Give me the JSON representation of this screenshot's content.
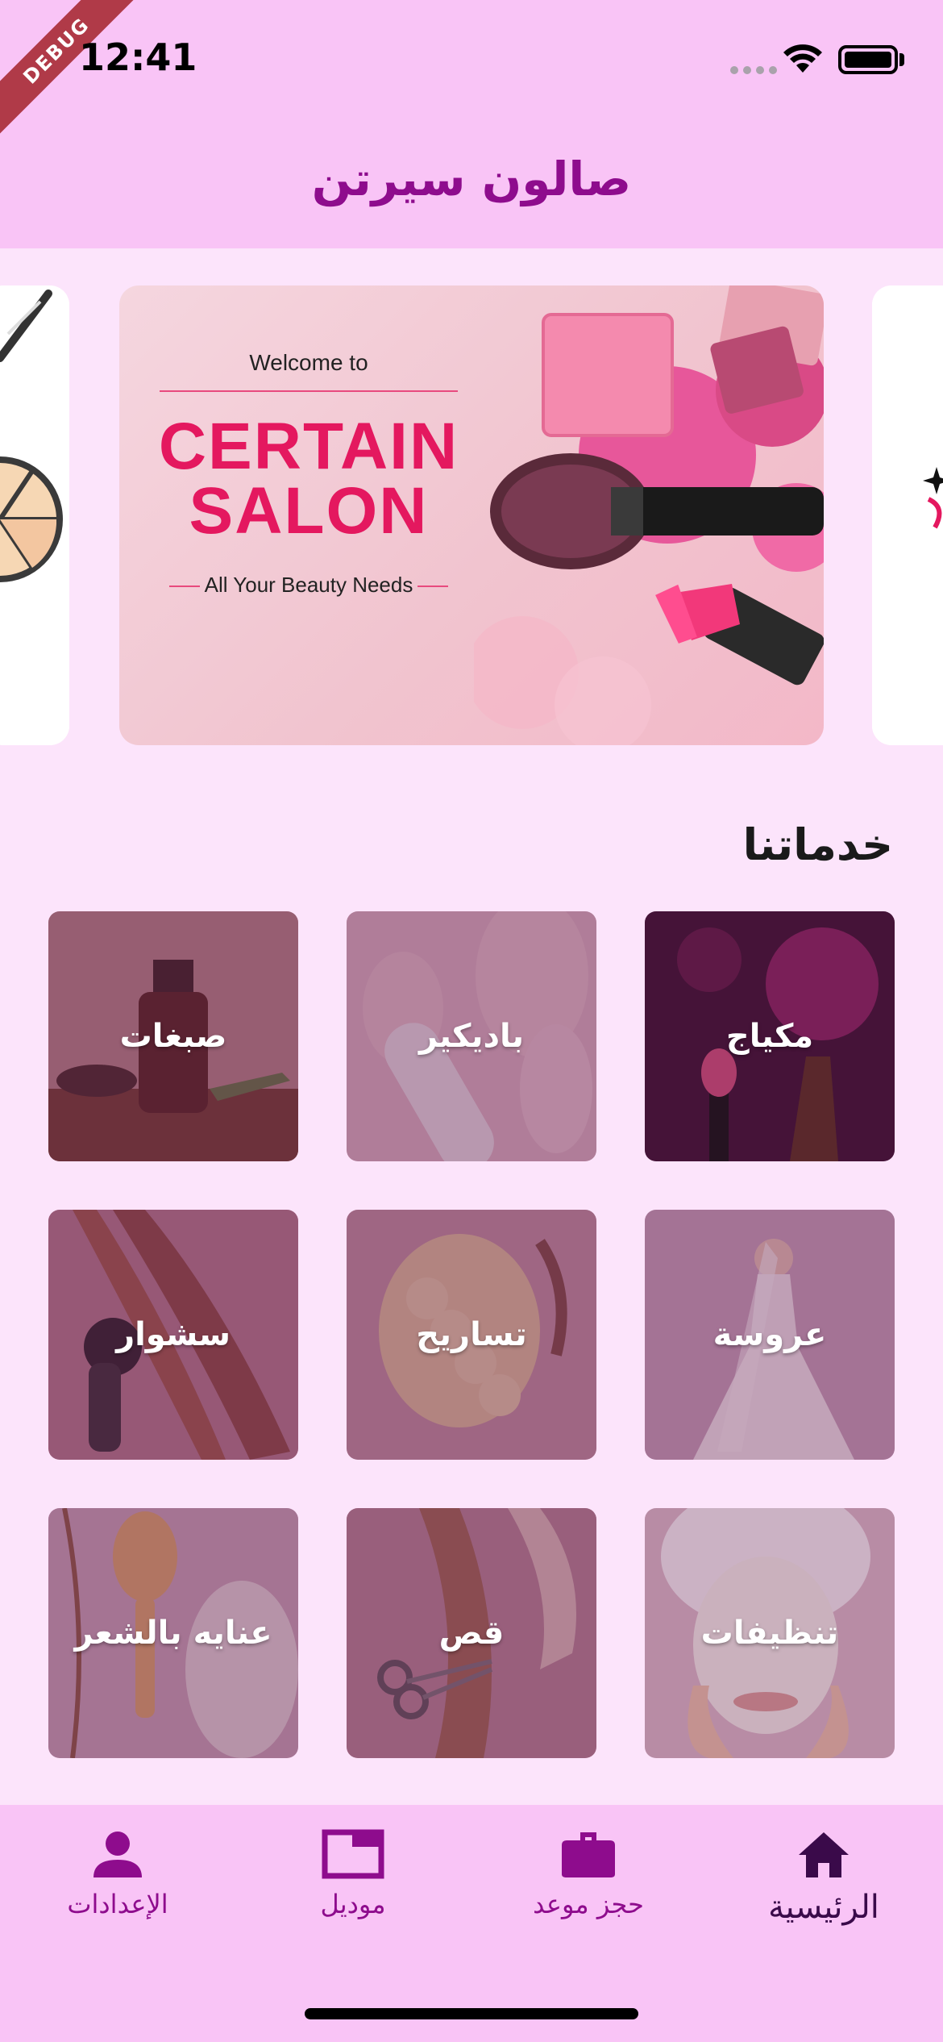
{
  "status_bar": {
    "time": "12:41",
    "debug_label": "DEBUG"
  },
  "header": {
    "title": "صالون سيرتن"
  },
  "carousel": {
    "main_slide": {
      "welcome": "Welcome to",
      "brand_line1": "CERTAIN",
      "brand_line2": "SALON",
      "tagline": "All Your Beauty Needs"
    }
  },
  "services": {
    "title": "خدماتنا",
    "items": [
      {
        "label": "مكياج",
        "color": "#5a1f4a"
      },
      {
        "label": "باديكير",
        "color": "#c9a3b3"
      },
      {
        "label": "صبغات",
        "color": "#7a3a3c"
      },
      {
        "label": "عروسة",
        "color": "#a97a98"
      },
      {
        "label": "تساريح",
        "color": "#9a6a7a"
      },
      {
        "label": "سشوار",
        "color": "#8e5066"
      },
      {
        "label": "تنظيفات",
        "color": "#b78a9e"
      },
      {
        "label": "قص",
        "color": "#92606f"
      },
      {
        "label": "عنايه بالشعر",
        "color": "#a77d8f"
      }
    ]
  },
  "bottom_nav": {
    "items": [
      {
        "label": "الرئيسية",
        "icon": "home-icon",
        "active": true
      },
      {
        "label": "حجز موعد",
        "icon": "briefcase-icon",
        "active": false
      },
      {
        "label": "موديل",
        "icon": "window-icon",
        "active": false
      },
      {
        "label": "الإعدادات",
        "icon": "person-icon",
        "active": false
      }
    ]
  },
  "colors": {
    "accent": "#8e0c8d",
    "header_bg": "#f9c4f6",
    "page_bg": "#fce4fb",
    "brand_pink": "#e4185f"
  }
}
